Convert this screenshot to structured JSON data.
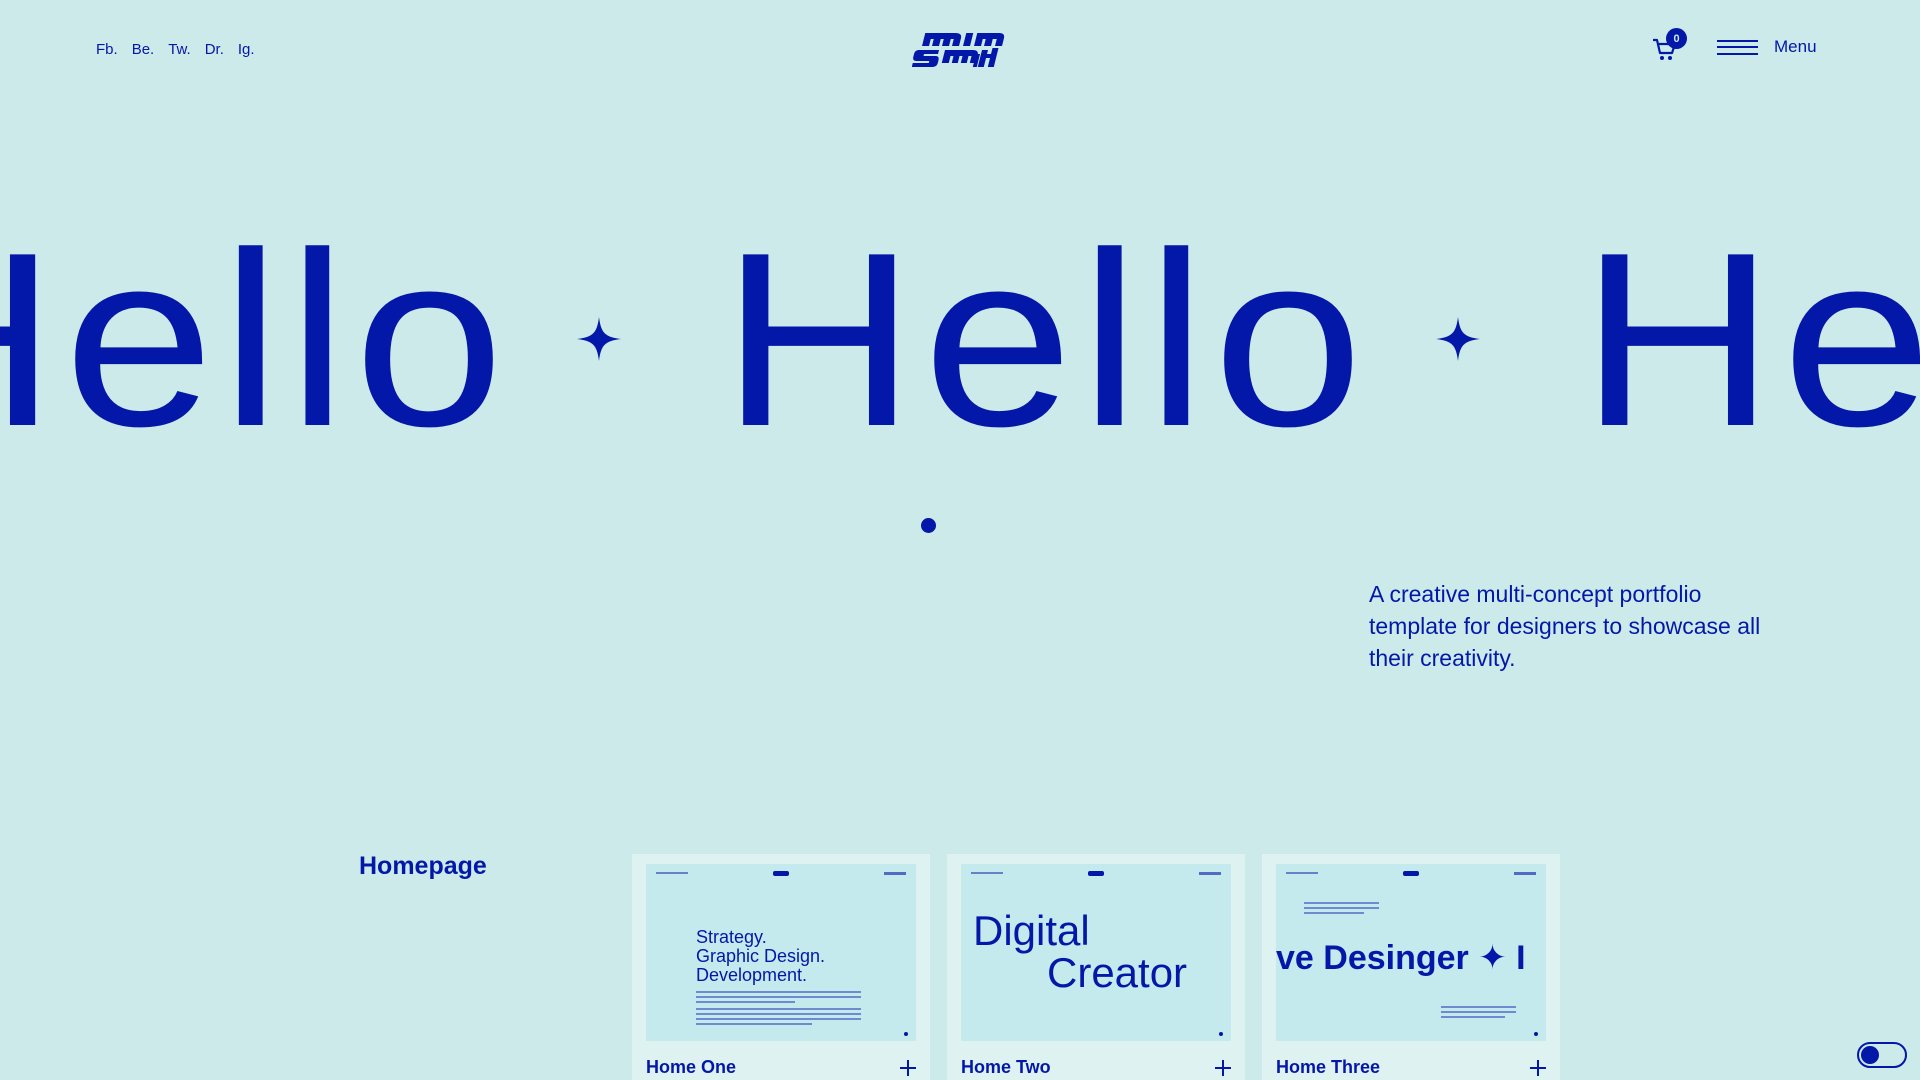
{
  "header": {
    "social_links": [
      {
        "label": "Fb.",
        "name": "social-link-facebook"
      },
      {
        "label": "Be.",
        "name": "social-link-behance"
      },
      {
        "label": "Tw.",
        "name": "social-link-twitter"
      },
      {
        "label": "Dr.",
        "name": "social-link-dribbble"
      },
      {
        "label": "Ig.",
        "name": "social-link-instagram"
      }
    ],
    "logo_text": "nina smith",
    "cart_count": "0",
    "menu_label": "Menu"
  },
  "hero": {
    "marquee_word": "Hello",
    "tagline": "A creative multi-concept portfolio template for designers to showcase all their creativity."
  },
  "homepage_section": {
    "title": "Homepage",
    "cards": [
      {
        "title": "Home One",
        "thumb_heading": [
          "Strategy.",
          "Graphic Design.",
          "Development."
        ]
      },
      {
        "title": "Home Two",
        "thumb_heading": [
          "Digital",
          "Creator"
        ]
      },
      {
        "title": "Home Three",
        "thumb_marquee": "ve Desinger  ✦  I"
      }
    ]
  },
  "colors": {
    "background": "#cdeaea",
    "accent": "#0318a8",
    "card_background": "#dff2f2",
    "thumb_background": "#c5eaed"
  }
}
